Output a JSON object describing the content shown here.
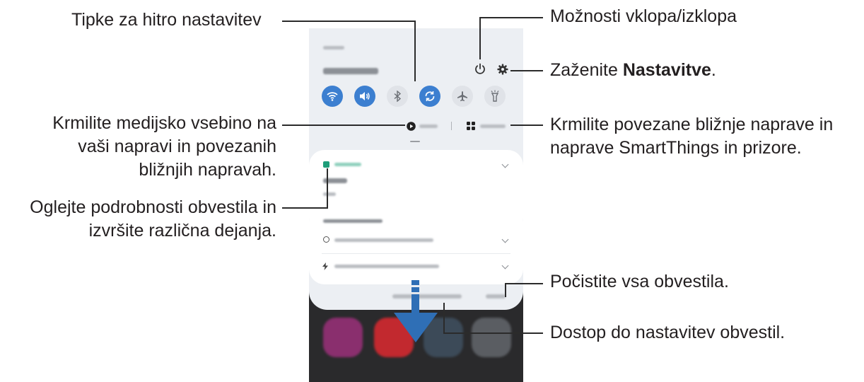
{
  "annotations": {
    "quick_settings": "Tipke za hitro nastavitev",
    "power_options": "Možnosti vklopa/izklopa",
    "launch_settings_prefix": "Zaženite ",
    "launch_settings_bold": "Nastavitve",
    "launch_settings_suffix": ".",
    "media_line1": "Krmilite medijsko vsebino na",
    "media_line2": "vaši napravi in povezanih",
    "media_line3": "bližnjih napravah.",
    "devices_line1": "Krmilite povezane bližnje naprave in",
    "devices_line2": "naprave SmartThings in prizore.",
    "notif_details_line1": "Oglejte podrobnosti obvestila in",
    "notif_details_line2": "izvršite različna dejanja.",
    "clear_all": "Počistite vsa obvestila.",
    "notif_settings": "Dostop do nastavitev obvestil."
  },
  "phone": {
    "quick_buttons": [
      {
        "name": "wifi-icon",
        "state": "on"
      },
      {
        "name": "sound-icon",
        "state": "on"
      },
      {
        "name": "bluetooth-icon",
        "state": "off"
      },
      {
        "name": "auto-rotate-icon",
        "state": "on"
      },
      {
        "name": "airplane-mode-icon",
        "state": "off"
      },
      {
        "name": "flashlight-icon",
        "state": "off"
      }
    ],
    "colors": {
      "active": "#3c7fd0",
      "inactive": "#e0e3e8",
      "panel": "#eceff3",
      "accent_green": "#1f9e7a",
      "arrow": "#2f6fb6"
    }
  }
}
